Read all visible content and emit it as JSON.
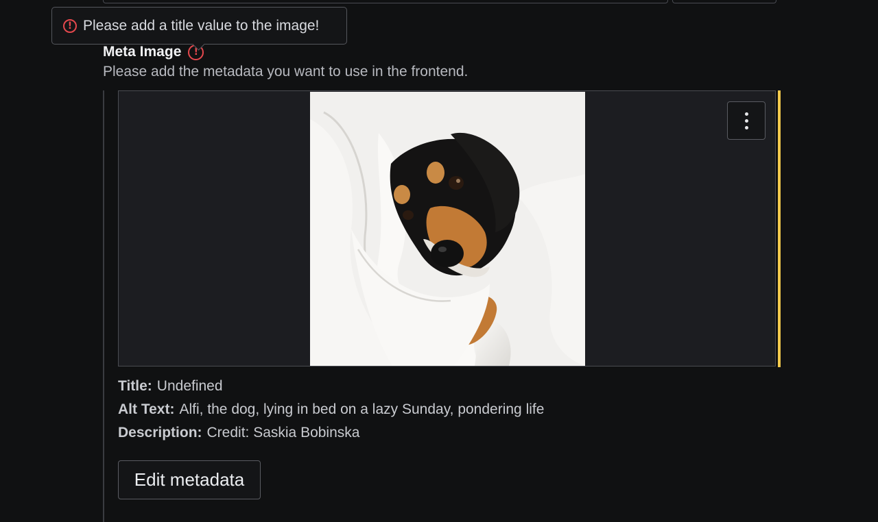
{
  "tooltip": {
    "message": "Please add a title value to the image!",
    "icon": "error-circle-icon",
    "icon_color": "#e5484d"
  },
  "field": {
    "label": "Meta Image",
    "description": "Please add the metadata you want to use in the frontend.",
    "status_icon": "error-circle-icon"
  },
  "preview": {
    "image_subject": "dog-photo",
    "menu_icon": "kebab-menu-icon",
    "accent_color": "#f2c94c"
  },
  "metadata": {
    "title_label": "Title:",
    "title_value": "Undefined",
    "alt_label": "Alt Text:",
    "alt_value": "Alfi, the dog, lying in bed on a lazy Sunday, pondering life",
    "description_label": "Description:",
    "description_value": "Credit: Saskia Bobinska"
  },
  "actions": {
    "edit_label": "Edit metadata"
  }
}
